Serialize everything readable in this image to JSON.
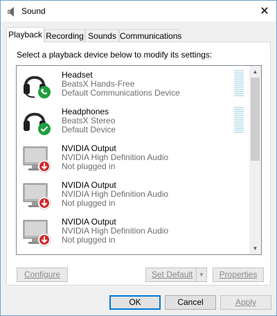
{
  "window": {
    "title": "Sound",
    "close": "✕"
  },
  "tabs": [
    {
      "label": "Playback",
      "active": true
    },
    {
      "label": "Recording",
      "active": false
    },
    {
      "label": "Sounds",
      "active": false
    },
    {
      "label": "Communications",
      "active": false
    }
  ],
  "playback": {
    "instruction": "Select a playback device below to modify its settings:",
    "devices": [
      {
        "name": "Headset",
        "line1": "BeatsX Hands-Free",
        "line2": "Default Communications Device",
        "icon": "headset-phone-icon",
        "badge": "phone-badge-icon"
      },
      {
        "name": "Headphones",
        "line1": "BeatsX Stereo",
        "line2": "Default Device",
        "icon": "headphones-icon",
        "badge": "checkmark-badge-icon"
      },
      {
        "name": "NVIDIA Output",
        "line1": "NVIDIA High Definition Audio",
        "line2": "Not plugged in",
        "icon": "monitor-icon",
        "badge": "down-arrow-badge-icon"
      },
      {
        "name": "NVIDIA Output",
        "line1": "NVIDIA High Definition Audio",
        "line2": "Not plugged in",
        "icon": "monitor-icon",
        "badge": "down-arrow-badge-icon"
      },
      {
        "name": "NVIDIA Output",
        "line1": "NVIDIA High Definition Audio",
        "line2": "Not plugged in",
        "icon": "monitor-icon",
        "badge": "down-arrow-badge-icon"
      }
    ]
  },
  "buttons": {
    "configure": "Configure",
    "set_default": "Set Default",
    "properties": "Properties",
    "ok": "OK",
    "cancel": "Cancel",
    "apply": "Apply"
  },
  "colors": {
    "accent": "#0078d7",
    "badge_green": "#1e9e3e",
    "badge_red": "#d22828"
  }
}
